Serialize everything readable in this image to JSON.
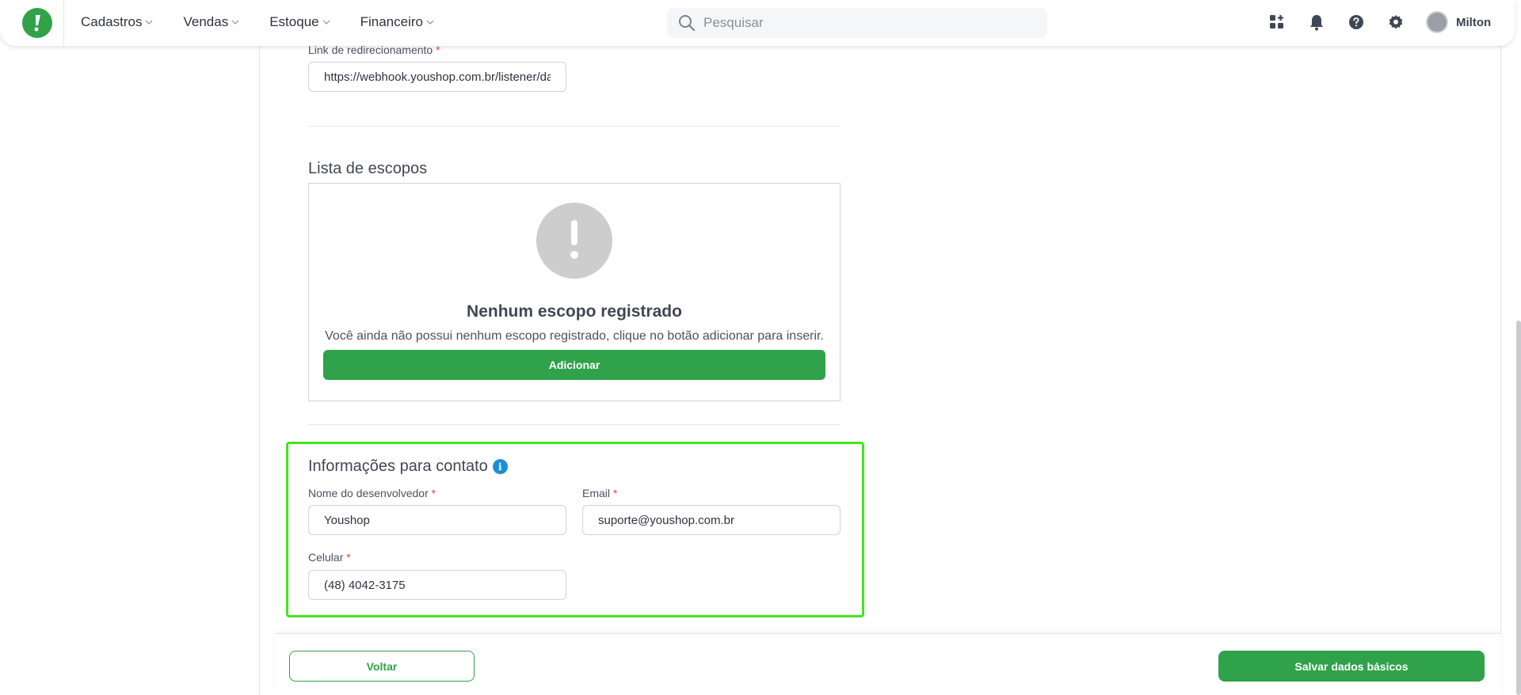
{
  "header": {
    "logo_icon": "exclamation-logo-icon",
    "nav": [
      {
        "label": "Cadastros"
      },
      {
        "label": "Vendas"
      },
      {
        "label": "Estoque"
      },
      {
        "label": "Financeiro"
      }
    ],
    "search": {
      "placeholder": "Pesquisar",
      "icon": "search-icon"
    },
    "icons": [
      "apps-icon",
      "bell-icon",
      "help-icon",
      "gear-icon"
    ],
    "user": {
      "name": "Milton"
    }
  },
  "form": {
    "redirect": {
      "label": "Link de redirecionamento",
      "required_mark": "*",
      "value": "https://webhook.youshop.com.br/listener/da"
    },
    "scopes": {
      "title": "Lista de escopos",
      "empty_title": "Nenhum escopo registrado",
      "empty_description": "Você ainda não possui nenhum escopo registrado, clique no botão adicionar para inserir.",
      "add_label": "Adicionar"
    },
    "contact": {
      "title": "Informações para contato",
      "info_glyph": "i",
      "developer_name": {
        "label": "Nome do desenvolvedor",
        "required_mark": "*",
        "value": "Youshop"
      },
      "email": {
        "label": "Email",
        "required_mark": "*",
        "value": "suporte@youshop.com.br"
      },
      "phone": {
        "label": "Celular",
        "required_mark": "*",
        "value": "(48) 4042-3175"
      }
    }
  },
  "footer": {
    "back_label": "Voltar",
    "save_label": "Salvar dados básicos"
  },
  "colors": {
    "brand_green": "#2fa24a",
    "highlight_border": "#44e51c",
    "info_blue": "#1a8fd8",
    "required": "#e0463c"
  }
}
